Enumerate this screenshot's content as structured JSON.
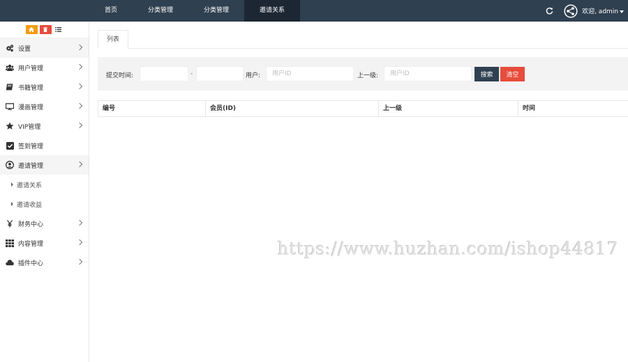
{
  "topnav": {
    "items": [
      {
        "label": "首页",
        "active": false
      },
      {
        "label": "分类管理",
        "active": false
      },
      {
        "label": "分类管理",
        "active": false
      },
      {
        "label": "邀请关系",
        "active": true
      }
    ]
  },
  "user": {
    "welcome": "欢迎, admin"
  },
  "sidebar": {
    "items": [
      {
        "label": "设置",
        "icon": "gears-icon"
      },
      {
        "label": "用户管理",
        "icon": "users-icon"
      },
      {
        "label": "书籍管理",
        "icon": "book-icon"
      },
      {
        "label": "漫画管理",
        "icon": "monitor-icon"
      },
      {
        "label": "VIP管理",
        "icon": "star-icon"
      },
      {
        "label": "签到管理",
        "icon": "checkbox-icon"
      },
      {
        "label": "邀请管理",
        "icon": "user-circle-icon"
      }
    ],
    "subitems": [
      {
        "label": "邀请关系"
      },
      {
        "label": "邀请收益"
      }
    ],
    "items2": [
      {
        "label": "财务中心",
        "icon": "yen-icon"
      },
      {
        "label": "内容管理",
        "icon": "grid-icon"
      },
      {
        "label": "插件中心",
        "icon": "cloud-icon"
      }
    ]
  },
  "tab": {
    "label": "列表"
  },
  "filter": {
    "time_label": "提交时间:",
    "dash": "-",
    "user_label": "用户:",
    "user_placeholder": "用户ID",
    "parent_label": "上一级:",
    "parent_placeholder": "用户ID",
    "search_btn": "搜索",
    "clear_btn": "清空"
  },
  "table": {
    "columns": [
      "编号",
      "会员(ID)",
      "上一级",
      "时间"
    ]
  },
  "watermark": "https://www.huzhan.com/ishop44817",
  "colors": {
    "topbar": "#2f4050",
    "active_nav": "#1d2733",
    "accent_red": "#e74c3c",
    "accent_orange": "#f39c12"
  }
}
